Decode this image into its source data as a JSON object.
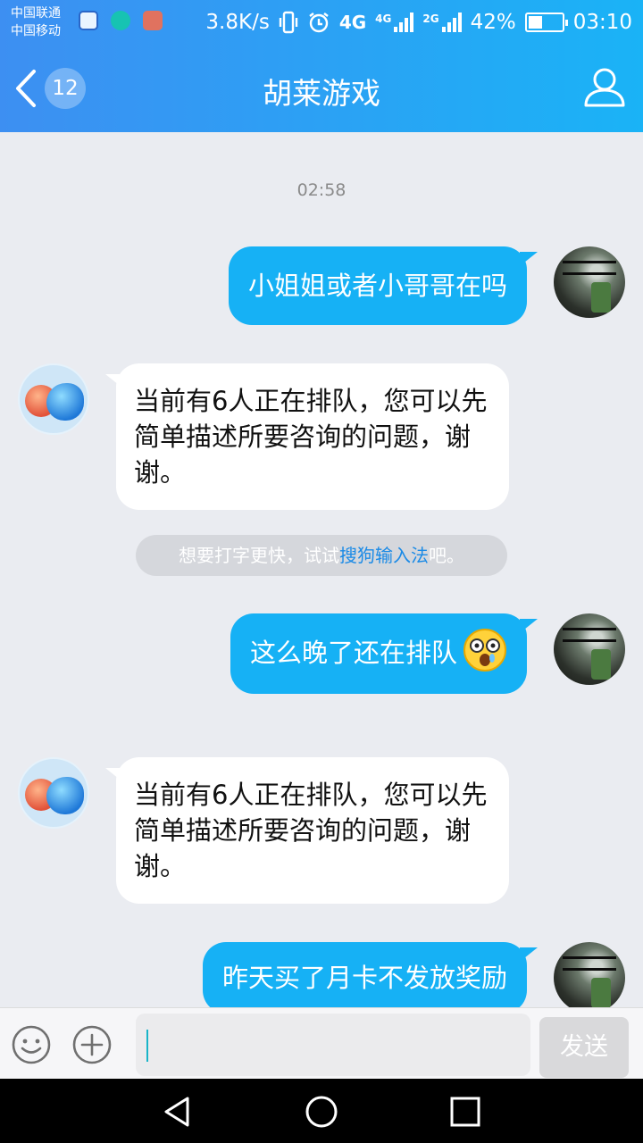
{
  "status_bar": {
    "carrier_1": "中国联通",
    "carrier_2": "中国移动",
    "speed": "3.8K/s",
    "net_1": "4G",
    "net_2": "4G",
    "net_3": "2G",
    "battery": "42%",
    "battery_level": 0.42,
    "time": "03:10"
  },
  "header": {
    "unread_count": "12",
    "title": "胡莱游戏"
  },
  "chat": {
    "timestamp": "02:58",
    "messages": [
      {
        "from": "me",
        "text": "小姐姐或者小哥哥在吗"
      },
      {
        "from": "bot",
        "text": "当前有6人正在排队，您可以先简单描述所要咨询的问题，谢谢。"
      },
      {
        "from": "me",
        "text": "这么晚了还在排队"
      },
      {
        "from": "bot",
        "text": "当前有6人正在排队，您可以先简单描述所要咨询的问题，谢谢。"
      },
      {
        "from": "me",
        "text": "昨天买了月卡不发放奖励"
      }
    ],
    "tip": {
      "prefix": "想要打字更快，试试",
      "link": "搜狗输入法",
      "suffix": "吧。"
    }
  },
  "input_bar": {
    "value": "",
    "send_label": "发送"
  },
  "colors": {
    "header_start": "#3d8ff2",
    "header_end": "#1ab3f6",
    "my_bubble": "#16b1f5",
    "bot_bubble": "#ffffff",
    "link": "#1a8ae6"
  },
  "icons": [
    "back-icon",
    "profile-icon",
    "emoji-face-icon",
    "plus-circle-icon",
    "nav-back-icon",
    "nav-home-icon",
    "nav-recent-icon"
  ]
}
